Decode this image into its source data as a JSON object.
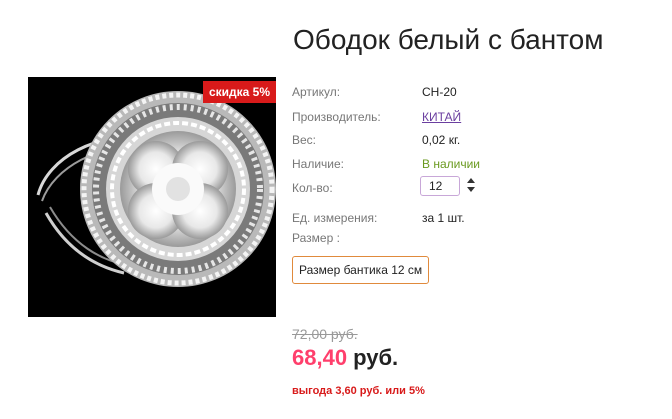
{
  "product": {
    "title": "Ободок белый с бантом",
    "discount_badge": "скидка 5%"
  },
  "specs": {
    "article_label": "Артикул:",
    "article_value": "CH-20",
    "manufacturer_label": "Производитель:",
    "manufacturer_value": "КИТАЙ",
    "weight_label": "Вес:",
    "weight_value": "0,02 кг.",
    "availability_label": "Наличие:",
    "availability_value": "В наличии",
    "quantity_label": "Кол-во:",
    "quantity_value": "12",
    "unit_label": "Ед. измерения:",
    "unit_value": "за 1 шт.",
    "size_label": "Размер :",
    "size_option": "Размер бантика 12 см"
  },
  "pricing": {
    "old_price": "72,00 руб.",
    "new_price_number": "68,40",
    "new_price_currency": "руб.",
    "savings": "выгода 3,60 руб. или 5%"
  },
  "colors": {
    "discount_badge": "#d81a1a",
    "new_price": "#ff3f6c",
    "in_stock": "#6a9a1f",
    "link": "#6b3fa0",
    "size_border": "#e08a3c"
  }
}
